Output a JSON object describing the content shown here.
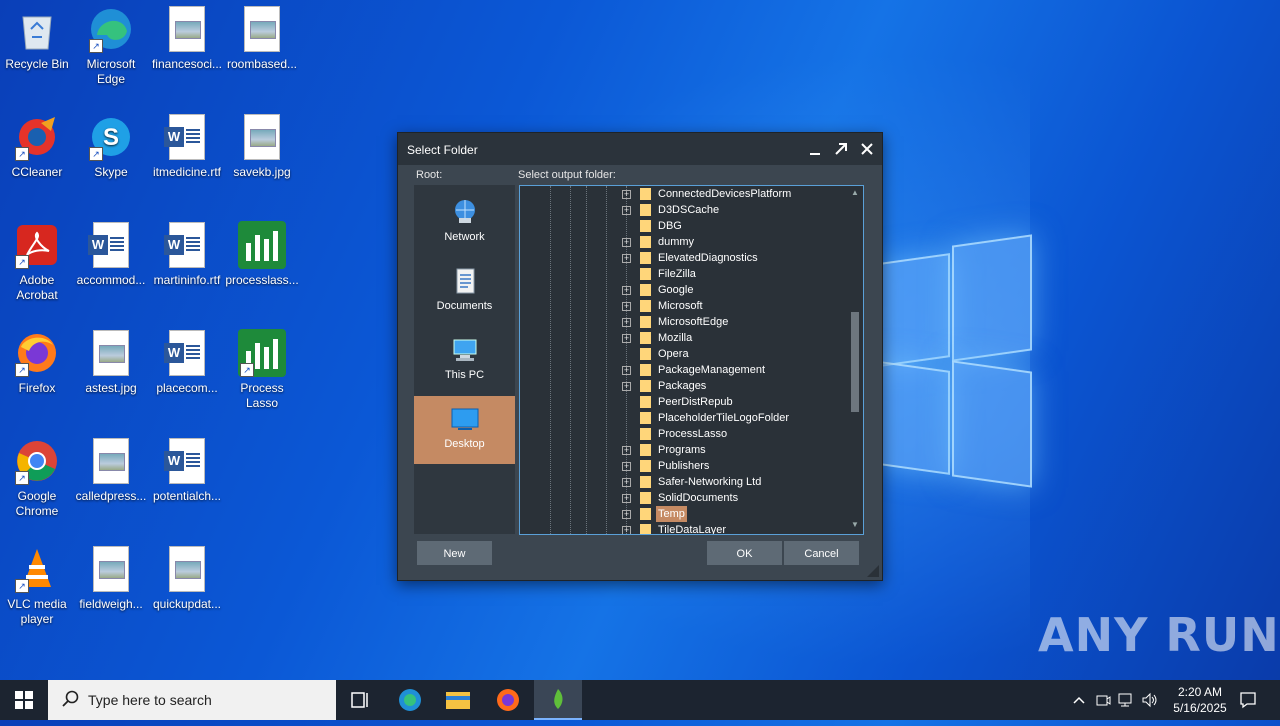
{
  "desktop": {
    "icons": [
      {
        "label": "Recycle Bin",
        "icon": "recycle-bin-icon"
      },
      {
        "label": "Microsoft Edge",
        "icon": "edge-icon"
      },
      {
        "label": "financesoci...",
        "icon": "image-file-icon"
      },
      {
        "label": "roombased...",
        "icon": "image-file-icon"
      },
      {
        "label": "CCleaner",
        "icon": "ccleaner-icon"
      },
      {
        "label": "Skype",
        "icon": "skype-icon"
      },
      {
        "label": "itmedicine.rtf",
        "icon": "word-doc-icon"
      },
      {
        "label": "savekb.jpg",
        "icon": "image-file-icon"
      },
      {
        "label": "Adobe Acrobat",
        "icon": "acrobat-icon"
      },
      {
        "label": "accommod...",
        "icon": "word-doc-icon"
      },
      {
        "label": "martininfo.rtf",
        "icon": "word-doc-icon"
      },
      {
        "label": "processlass...",
        "icon": "process-lasso-icon"
      },
      {
        "label": "Firefox",
        "icon": "firefox-icon"
      },
      {
        "label": "astest.jpg",
        "icon": "image-file-icon"
      },
      {
        "label": "placecom...",
        "icon": "word-doc-icon"
      },
      {
        "label": "Process Lasso",
        "icon": "process-lasso-icon"
      },
      {
        "label": "Google Chrome",
        "icon": "chrome-icon"
      },
      {
        "label": "calledpress...",
        "icon": "image-file-icon"
      },
      {
        "label": "potentialch...",
        "icon": "word-doc-icon"
      },
      {
        "label": "VLC media player",
        "icon": "vlc-icon"
      },
      {
        "label": "fieldweigh...",
        "icon": "image-file-icon"
      },
      {
        "label": "quickupdat...",
        "icon": "image-file-icon"
      }
    ]
  },
  "dialog": {
    "title": "Select Folder",
    "root_label": "Root:",
    "output_label": "Select output folder:",
    "places": [
      {
        "label": "Network",
        "icon": "network-icon"
      },
      {
        "label": "Documents",
        "icon": "documents-icon"
      },
      {
        "label": "This PC",
        "icon": "this-pc-icon"
      },
      {
        "label": "Desktop",
        "icon": "desktop-icon",
        "selected": true
      }
    ],
    "folders": [
      {
        "name": "ConnectedDevicesPlatform",
        "expandable": true
      },
      {
        "name": "D3DSCache",
        "expandable": true
      },
      {
        "name": "DBG",
        "expandable": false
      },
      {
        "name": "dummy",
        "expandable": true
      },
      {
        "name": "ElevatedDiagnostics",
        "expandable": true
      },
      {
        "name": "FileZilla",
        "expandable": false
      },
      {
        "name": "Google",
        "expandable": true
      },
      {
        "name": "Microsoft",
        "expandable": true
      },
      {
        "name": "MicrosoftEdge",
        "expandable": true
      },
      {
        "name": "Mozilla",
        "expandable": true
      },
      {
        "name": "Opera",
        "expandable": false
      },
      {
        "name": "PackageManagement",
        "expandable": true
      },
      {
        "name": "Packages",
        "expandable": true
      },
      {
        "name": "PeerDistRepub",
        "expandable": false
      },
      {
        "name": "PlaceholderTileLogoFolder",
        "expandable": false
      },
      {
        "name": "ProcessLasso",
        "expandable": false
      },
      {
        "name": "Programs",
        "expandable": true
      },
      {
        "name": "Publishers",
        "expandable": true
      },
      {
        "name": "Safer-Networking Ltd",
        "expandable": true
      },
      {
        "name": "SolidDocuments",
        "expandable": true
      },
      {
        "name": "Temp",
        "expandable": true,
        "selected": true
      },
      {
        "name": "TileDataLayer",
        "expandable": true
      }
    ],
    "new_label": "New",
    "ok_label": "OK",
    "cancel_label": "Cancel"
  },
  "taskbar": {
    "search_placeholder": "Type here to search",
    "time": "2:20 AM",
    "date": "5/16/2025"
  },
  "watermark": "ANY RUN"
}
